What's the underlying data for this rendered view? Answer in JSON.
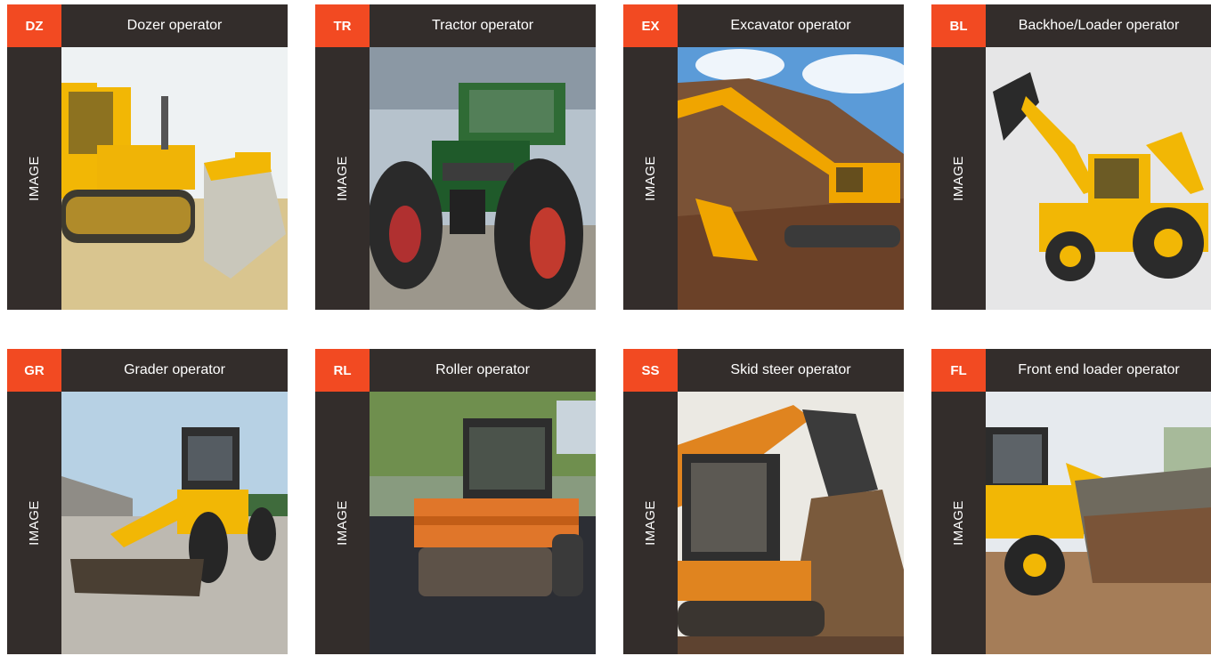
{
  "cards": [
    {
      "code": "DZ",
      "title": "Dozer operator",
      "side": "IMAGE",
      "photo": "dozer-photo",
      "sky": "#eef1f2",
      "ground": "#d8c48f"
    },
    {
      "code": "TR",
      "title": "Tractor operator",
      "side": "IMAGE",
      "photo": "tractor-photo",
      "sky": "#bcc7cf",
      "ground": "#a8a296"
    },
    {
      "code": "EX",
      "title": "Excavator operator",
      "side": "IMAGE",
      "photo": "excavator-photo",
      "sky": "#6fa9df",
      "ground": "#8a5f3f"
    },
    {
      "code": "BL",
      "title": "Backhoe/Loader operator",
      "side": "IMAGE",
      "photo": "backhoe-loader-photo",
      "sky": "#e7e7e8",
      "ground": "#e7e7e8"
    },
    {
      "code": "GR",
      "title": "Grader operator",
      "side": "IMAGE",
      "photo": "grader-photo",
      "sky": "#b9d3e6",
      "ground": "#b9b5ad"
    },
    {
      "code": "RL",
      "title": "Roller operator",
      "side": "IMAGE",
      "photo": "roller-photo",
      "sky": "#7b9a5a",
      "ground": "#2e3036"
    },
    {
      "code": "SS",
      "title": "Skid steer operator",
      "side": "IMAGE",
      "photo": "skid-steer-photo",
      "sky": "#eceae4",
      "ground": "#8a6446"
    },
    {
      "code": "FL",
      "title": "Front end loader operator",
      "side": "IMAGE",
      "photo": "front-end-loader-photo",
      "sky": "#e8ecef",
      "ground": "#a07a55"
    }
  ],
  "colors": {
    "accent": "#f24a22",
    "dark": "#332d2b",
    "machine": "#f2b705"
  }
}
